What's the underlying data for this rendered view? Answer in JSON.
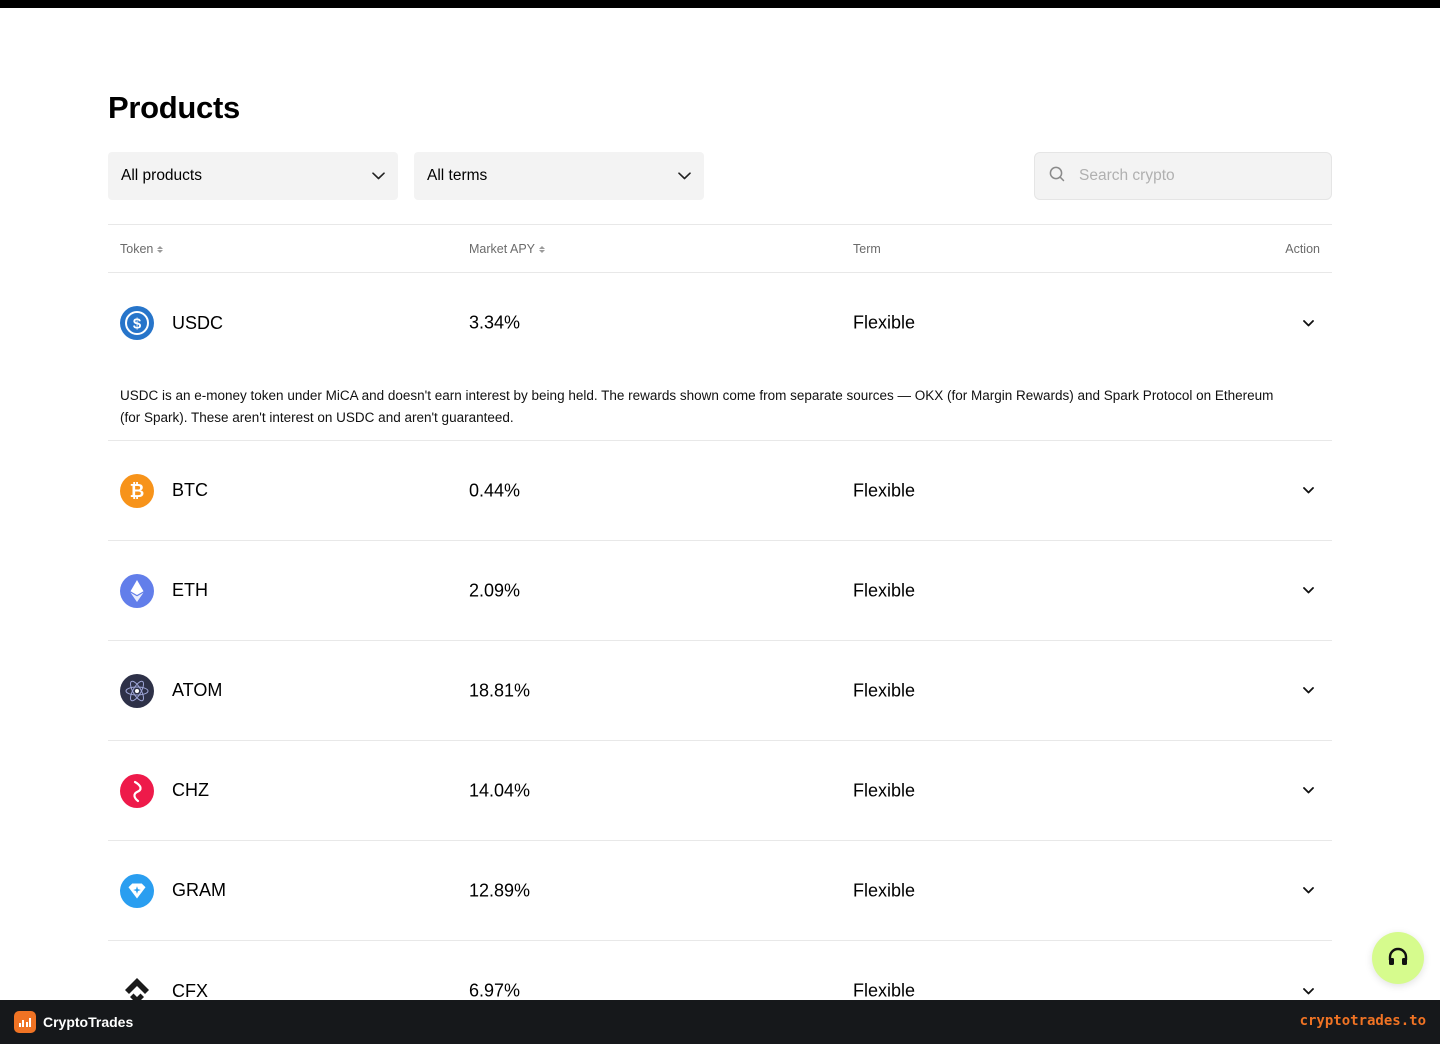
{
  "page": {
    "title": "Products"
  },
  "filters": {
    "products": {
      "selected": "All products"
    },
    "terms": {
      "selected": "All terms"
    },
    "search": {
      "placeholder": "Search crypto"
    }
  },
  "table": {
    "headers": {
      "token": "Token",
      "apy": "Market APY",
      "term": "Term",
      "action": "Action"
    },
    "rows": [
      {
        "token": "USDC",
        "apy": "3.34%",
        "term": "Flexible",
        "icon": "usdc-icon",
        "color": "#2775ca",
        "description": "USDC is an e-money token under MiCA and doesn't earn interest by being held. The rewards shown come from separate sources — OKX (for Margin Rewards) and Spark Protocol on Ethereum (for Spark). These aren't interest on USDC and aren't guaranteed."
      },
      {
        "token": "BTC",
        "apy": "0.44%",
        "term": "Flexible",
        "icon": "btc-icon",
        "color": "#f7931a"
      },
      {
        "token": "ETH",
        "apy": "2.09%",
        "term": "Flexible",
        "icon": "eth-icon",
        "color": "#627eea"
      },
      {
        "token": "ATOM",
        "apy": "18.81%",
        "term": "Flexible",
        "icon": "atom-icon",
        "color": "#2e3148"
      },
      {
        "token": "CHZ",
        "apy": "14.04%",
        "term": "Flexible",
        "icon": "chz-icon",
        "color": "#ee1a4a"
      },
      {
        "token": "GRAM",
        "apy": "12.89%",
        "term": "Flexible",
        "icon": "gram-icon",
        "color": "#2a9ef0"
      },
      {
        "token": "CFX",
        "apy": "6.97%",
        "term": "Flexible",
        "icon": "cfx-icon",
        "color": "#1a1a1a"
      }
    ]
  },
  "footer": {
    "brand": "CryptoTrades",
    "url": "cryptotrades.to",
    "accent": "#f07324"
  },
  "support": {
    "icon": "headset-icon",
    "color": "#d6fb8d"
  }
}
